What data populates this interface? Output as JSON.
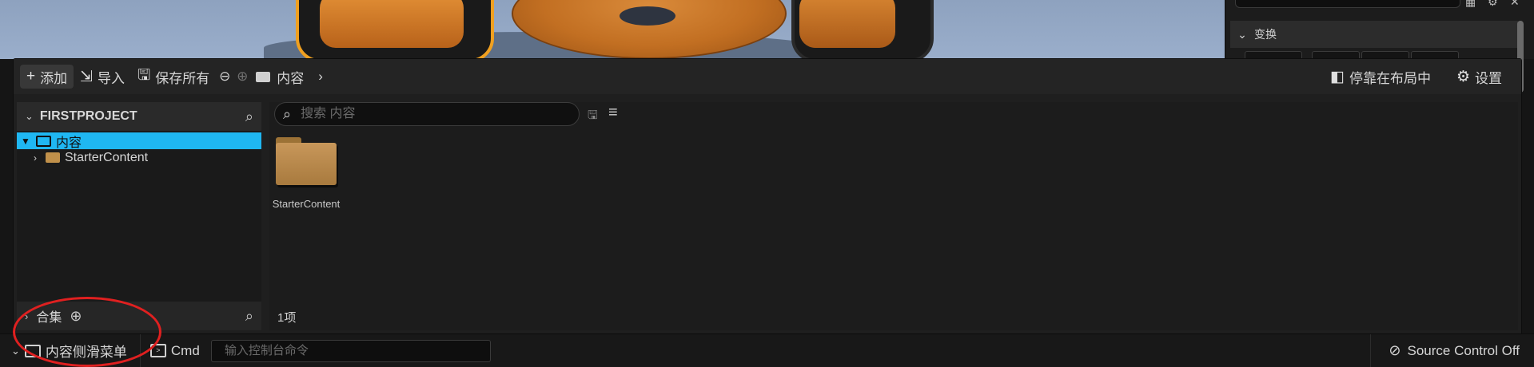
{
  "toolbar": {
    "add_label": "添加",
    "import_label": "导入",
    "save_all_label": "保存所有",
    "breadcrumb": "内容",
    "dock_label": "停靠在布局中",
    "settings_label": "设置"
  },
  "sidebar": {
    "project_title": "FIRSTPROJECT",
    "tree": [
      {
        "label": "内容",
        "selected": true,
        "expanded": true
      },
      {
        "label": "StarterContent",
        "selected": false,
        "expanded": false
      }
    ],
    "collections_label": "合集"
  },
  "main": {
    "search_placeholder": "搜索 内容",
    "assets": [
      {
        "name": "StarterContent",
        "type": "folder"
      }
    ],
    "item_count": "1项"
  },
  "details": {
    "section_label": "变换"
  },
  "statusbar": {
    "drawer_label": "内容侧滑菜单",
    "cmd_label": "Cmd",
    "console_placeholder": "输入控制台命令",
    "source_control_label": "Source Control Off"
  },
  "colors": {
    "selection": "#1fb7f2",
    "folder": "#c0904a",
    "annotation": "#e02020"
  }
}
